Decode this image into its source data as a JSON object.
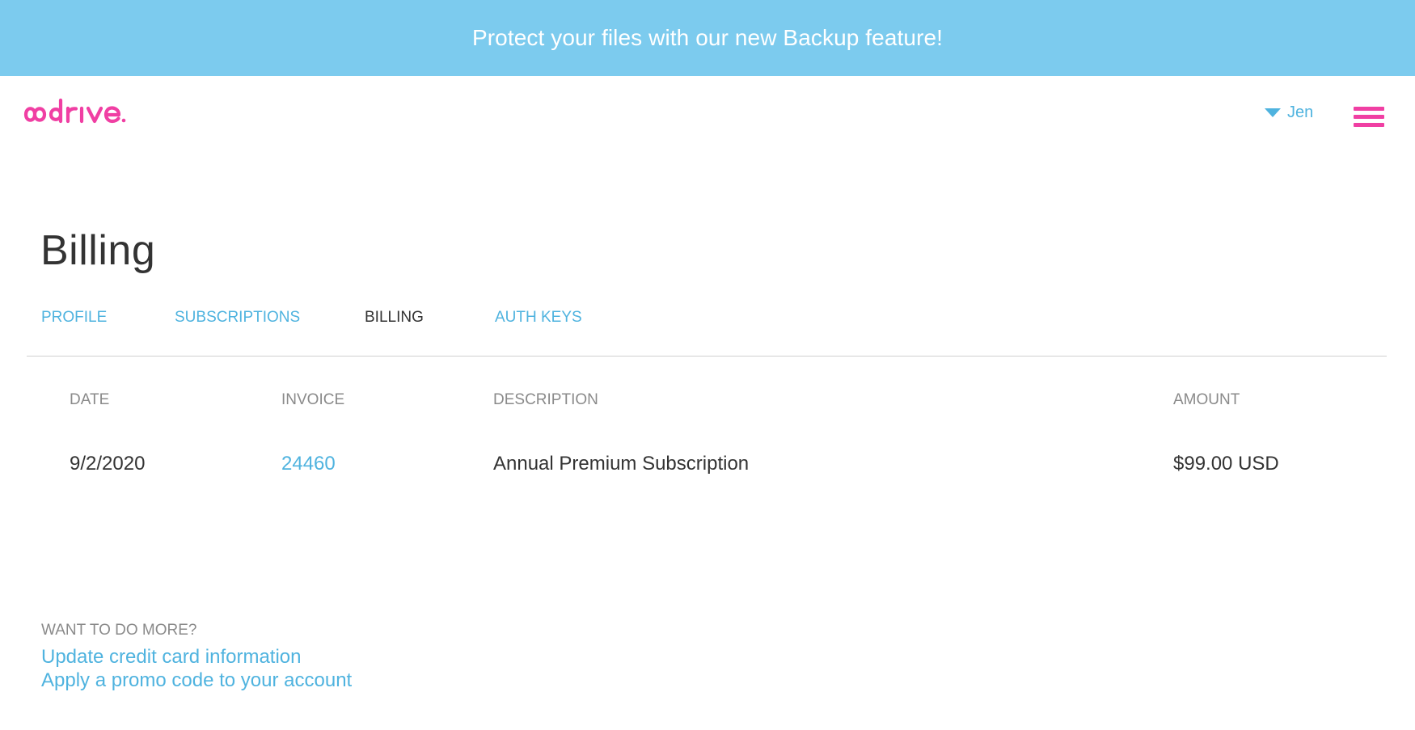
{
  "banner": {
    "text": "Protect your files with our new Backup feature!"
  },
  "header": {
    "logo_text": "odrive.",
    "user_name": "Jen"
  },
  "page": {
    "title": "Billing"
  },
  "tabs": [
    {
      "label": "PROFILE",
      "active": false
    },
    {
      "label": "SUBSCRIPTIONS",
      "active": false
    },
    {
      "label": "BILLING",
      "active": true
    },
    {
      "label": "AUTH KEYS",
      "active": false
    }
  ],
  "table": {
    "columns": [
      "DATE",
      "INVOICE",
      "DESCRIPTION",
      "AMOUNT"
    ],
    "rows": [
      {
        "date": "9/2/2020",
        "invoice": "24460",
        "description": "Annual Premium Subscription",
        "amount": "$99.00 USD"
      }
    ]
  },
  "more": {
    "label": "WANT TO DO MORE?",
    "links": [
      "Update credit card information",
      "Apply a promo code to your account"
    ]
  },
  "colors": {
    "banner": "#7ccbee",
    "accent_blue": "#4fb3df",
    "brand_pink": "#f03fa3",
    "text_dark": "#333333",
    "text_muted": "#8a8a8a"
  },
  "icons": {
    "user_dropdown": "caret-down-icon",
    "menu": "hamburger-menu-icon"
  }
}
